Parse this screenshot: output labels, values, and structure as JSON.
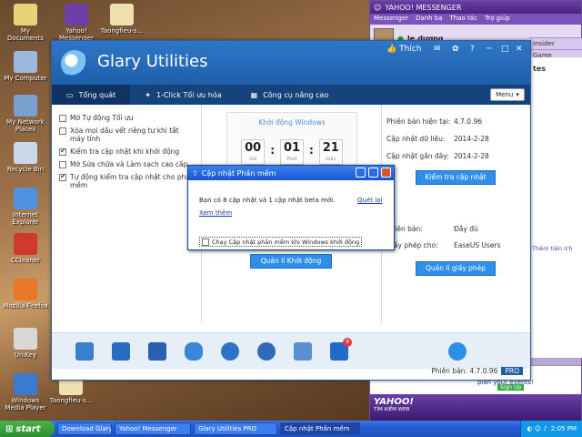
{
  "desktop": {
    "icons": [
      {
        "label": "My Documents",
        "color": "#e8d27a"
      },
      {
        "label": "My Computer",
        "color": "#9cb8dc"
      },
      {
        "label": "My Network Places",
        "color": "#7aa0d0"
      },
      {
        "label": "Recycle Bin",
        "color": "#c8d8e8"
      },
      {
        "label": "Internet Explorer",
        "color": "#4f93e0"
      },
      {
        "label": "CCleaner",
        "color": "#d03a2c"
      },
      {
        "label": "Mozilla Firefox",
        "color": "#e8772a"
      },
      {
        "label": "UniKey",
        "color": "#d8d8d8"
      },
      {
        "label": "Windows Media Player",
        "color": "#3a7ad0"
      },
      {
        "label": "Yahoo! Messenger",
        "color": "#6b3fa6"
      },
      {
        "label": "Taongfieu-s...",
        "color": "#f0e0b0"
      },
      {
        "label": "Taongfieu-s...",
        "color": "#f0e0b0"
      }
    ]
  },
  "yahoo": {
    "title": "YAHOO! MESSENGER",
    "menu": [
      "Messenger",
      "Danh bạ",
      "Thao tác",
      "Trợ giúp"
    ],
    "user": "le.dương",
    "insider": "Insider",
    "game": "Game",
    "side_text": "tes",
    "side_link": "Thêm tiện ích",
    "ad_title": "See Facebook to plan your events!",
    "ad_sub": "Sign Up",
    "bottom_brand": "YAHOO!",
    "bottom_sub": "TÌM KIẾM WEB"
  },
  "glary": {
    "title": "Glary Utilities",
    "like": "Thích",
    "tabs": [
      "Tổng quát",
      "1-Click Tối ưu hóa",
      "Công cụ nâng cao"
    ],
    "menu_label": "Menu",
    "options": [
      {
        "label": "Mở Tự động Tối ưu",
        "checked": false
      },
      {
        "label": "Xóa mọi dấu vết riêng tư khi tắt máy tính",
        "checked": false
      },
      {
        "label": "Kiểm tra cập nhật khi khởi động",
        "checked": true
      },
      {
        "label": "Mở Sửa chữa và Làm sạch cao cấp",
        "checked": false
      },
      {
        "label": "Tự động kiểm tra cập nhật cho phần mềm",
        "checked": true
      }
    ],
    "startup": {
      "title": "Khởi động Windows",
      "hours": "00",
      "hours_label": "Giờ",
      "minutes": "01",
      "minutes_label": "Phút",
      "seconds": "21",
      "seconds_label": "Giây",
      "button": "Quản lí Khởi động"
    },
    "info": {
      "version_label": "Phiên bản hiện tại:",
      "version": "4.7.0.96",
      "data_label": "Cập nhật dữ liệu:",
      "data": "2014-2-28",
      "recent_label": "Cập nhật gần đây:",
      "recent": "2014-2-28",
      "check_button": "Kiểm tra cập nhật",
      "edition_label": "Phiên bản:",
      "edition": "Đầy đủ",
      "license_label": "Giấy phép cho:",
      "license": "EaseUS Users",
      "license_button": "Quản lí giấy phép"
    },
    "badge": "9",
    "footer_label": "Phiên bản: 4.7.0.96",
    "footer_pro": "PRO"
  },
  "dialog": {
    "title": "Cập nhật Phần mềm",
    "message": "Bạn có 8 cập nhật và 1 cập nhật beta mới.",
    "rescan": "Quét lại",
    "view_more": "Xem thêm",
    "checkbox": "Chạy Cập nhật phần mềm khi Windows khởi động"
  },
  "taskbar": {
    "start": "start",
    "items": [
      "Download Glary Utiliti...",
      "Yahoo! Messenger",
      "Glary Utilities PRO",
      "Cập nhật Phần mềm"
    ],
    "time": "2:05 PM"
  }
}
